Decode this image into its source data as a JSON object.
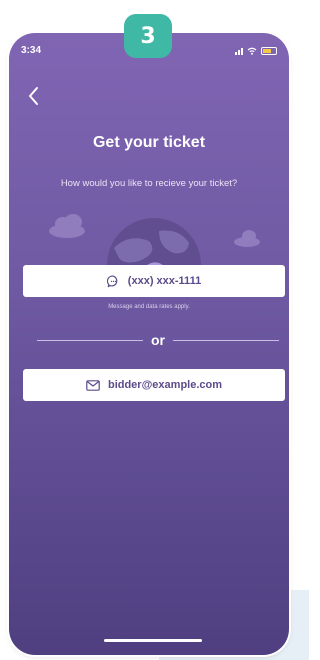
{
  "step_badge": "3",
  "status_bar": {
    "time": "3:34"
  },
  "screen": {
    "title": "Get your ticket",
    "subtitle": "How would you like to recieve your ticket?"
  },
  "sms_option": {
    "phone_value": "(xxx) xxx-1111",
    "disclaimer": "Message and data rates apply.",
    "icon": "chat-bubble-icon"
  },
  "divider_text": "or",
  "email_option": {
    "email_value": "bidder@example.com",
    "icon": "envelope-icon"
  },
  "colors": {
    "screen_gradient_top": "#8065b3",
    "screen_gradient_bottom": "#4f3f80",
    "badge": "#3fb8a6",
    "field_text": "#5b4b8a"
  }
}
